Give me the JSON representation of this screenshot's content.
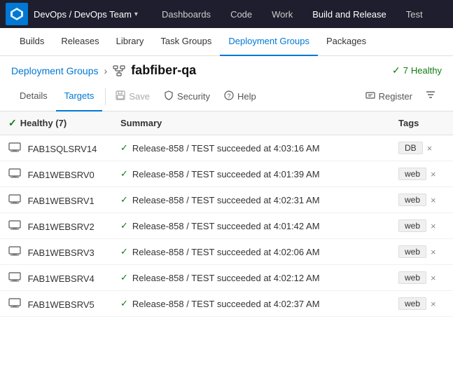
{
  "topnav": {
    "logo_label": "Azure DevOps",
    "org_label": "DevOps / DevOps Team",
    "caret": "▾",
    "items": [
      {
        "id": "dashboards",
        "label": "Dashboards",
        "active": false
      },
      {
        "id": "code",
        "label": "Code",
        "active": false
      },
      {
        "id": "work",
        "label": "Work",
        "active": false
      },
      {
        "id": "build-release",
        "label": "Build and Release",
        "active": true
      },
      {
        "id": "test",
        "label": "Test",
        "active": false
      }
    ]
  },
  "secondnav": {
    "items": [
      {
        "id": "builds",
        "label": "Builds",
        "active": false
      },
      {
        "id": "releases",
        "label": "Releases",
        "active": false
      },
      {
        "id": "library",
        "label": "Library",
        "active": false
      },
      {
        "id": "task-groups",
        "label": "Task Groups",
        "active": false
      },
      {
        "id": "deployment-groups",
        "label": "Deployment Groups",
        "active": true
      },
      {
        "id": "packages",
        "label": "Packages",
        "active": false
      }
    ]
  },
  "breadcrumb": {
    "parent_label": "Deployment Groups",
    "separator": "›",
    "current_label": "fabfiber-qa",
    "status_count": "7",
    "status_label": "Healthy",
    "check": "✓"
  },
  "toolbar": {
    "tabs": [
      {
        "id": "details",
        "label": "Details",
        "active": false
      },
      {
        "id": "targets",
        "label": "Targets",
        "active": true
      }
    ],
    "save_label": "Save",
    "security_label": "Security",
    "help_label": "Help",
    "register_label": "Register"
  },
  "table": {
    "columns": [
      {
        "id": "status",
        "label": "Healthy (7)"
      },
      {
        "id": "summary",
        "label": "Summary"
      },
      {
        "id": "tags",
        "label": "Tags"
      }
    ],
    "rows": [
      {
        "name": "FAB1SQLSRV14",
        "summary": "Release-858 / TEST succeeded at 4:03:16 AM",
        "tags": [
          "DB"
        ]
      },
      {
        "name": "FAB1WEBSRV0",
        "summary": "Release-858 / TEST succeeded at 4:01:39 AM",
        "tags": [
          "web"
        ]
      },
      {
        "name": "FAB1WEBSRV1",
        "summary": "Release-858 / TEST succeeded at 4:02:31 AM",
        "tags": [
          "web"
        ]
      },
      {
        "name": "FAB1WEBSRV2",
        "summary": "Release-858 / TEST succeeded at 4:01:42 AM",
        "tags": [
          "web"
        ]
      },
      {
        "name": "FAB1WEBSRV3",
        "summary": "Release-858 / TEST succeeded at 4:02:06 AM",
        "tags": [
          "web"
        ]
      },
      {
        "name": "FAB1WEBSRV4",
        "summary": "Release-858 / TEST succeeded at 4:02:12 AM",
        "tags": [
          "web"
        ]
      },
      {
        "name": "FAB1WEBSRV5",
        "summary": "Release-858 / TEST succeeded at 4:02:37 AM",
        "tags": [
          "web"
        ]
      }
    ]
  }
}
